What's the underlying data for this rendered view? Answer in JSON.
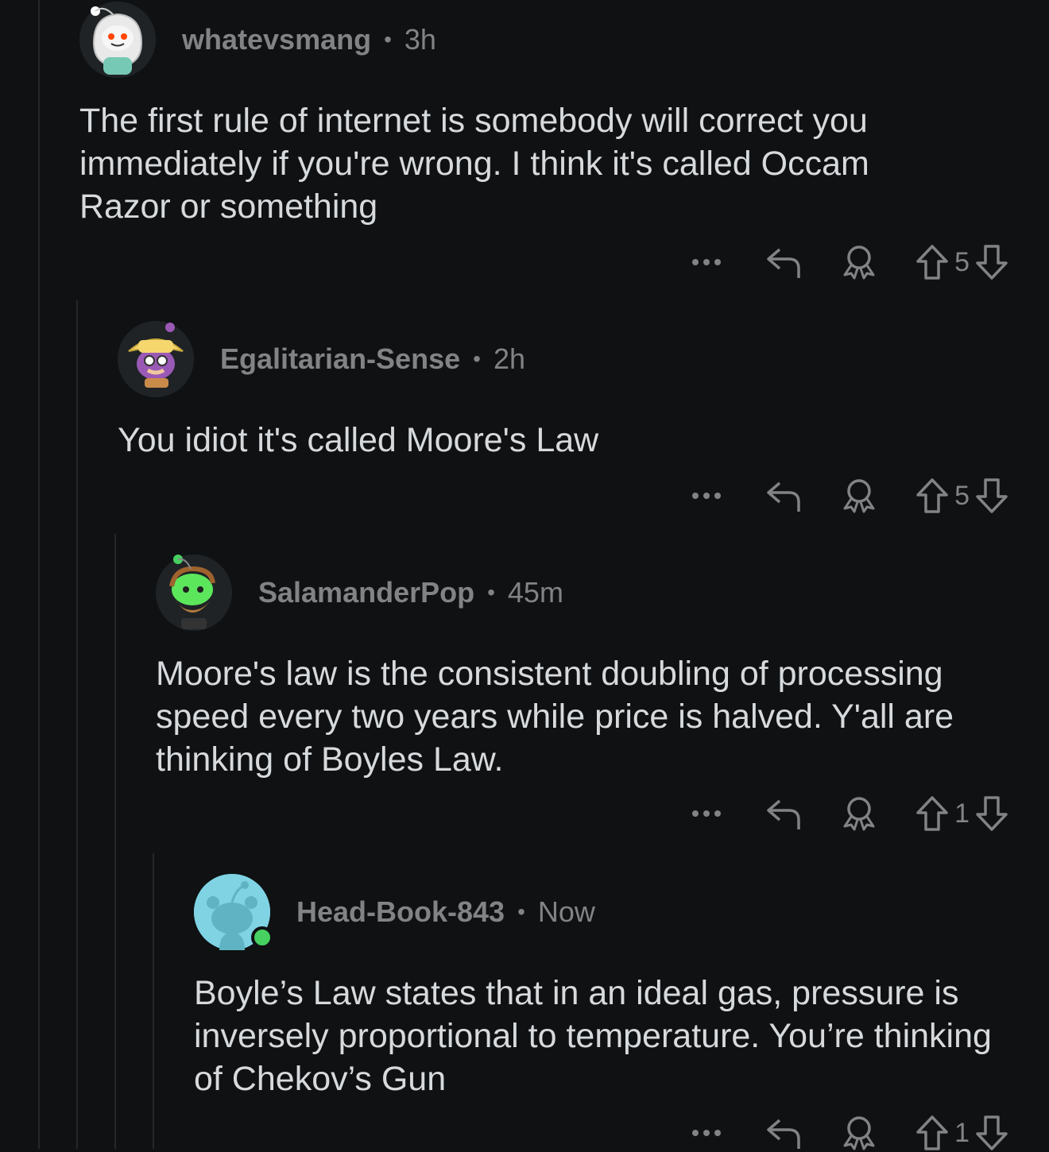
{
  "comments": [
    {
      "username": "whatevsmang",
      "separator": "•",
      "time": "3h",
      "body": "The first rule of internet is somebody will correct you immediately if you're wrong. I think it's called Occam Razor or something",
      "votes": "5",
      "avatar_icon": "snoo-hooded-avatar-icon"
    },
    {
      "username": "Egalitarian-Sense",
      "separator": "•",
      "time": "2h",
      "body": "You idiot it's called Moore's Law",
      "votes": "5",
      "avatar_icon": "snoo-bucket-hat-avatar-icon"
    },
    {
      "username": "SalamanderPop",
      "separator": "•",
      "time": "45m",
      "body": "Moore's law is the consistent doubling of processing speed every two years while price is halved. Y'all are thinking of Boyles Law.",
      "votes": "1",
      "avatar_icon": "snoo-green-bearded-avatar-icon"
    },
    {
      "username": "Head-Book-843",
      "separator": "•",
      "time": "Now",
      "body": "Boyle’s Law states that in an ideal gas, pressure is inversely proportional to temperature. You’re thinking of Chekov’s Gun",
      "votes": "1",
      "avatar_icon": "default-snoo-avatar-icon"
    }
  ],
  "icons": {
    "more": "more-options-icon",
    "reply": "reply-icon",
    "award": "award-icon",
    "upvote": "upvote-icon",
    "downvote": "downvote-icon",
    "online": "online-status-icon"
  },
  "colors": {
    "background": "#0f1113",
    "text": "#d7dadc",
    "meta": "#818384",
    "thread_line": "#24282b",
    "online": "#46d160",
    "default_avatar": "#7fd3e3"
  }
}
